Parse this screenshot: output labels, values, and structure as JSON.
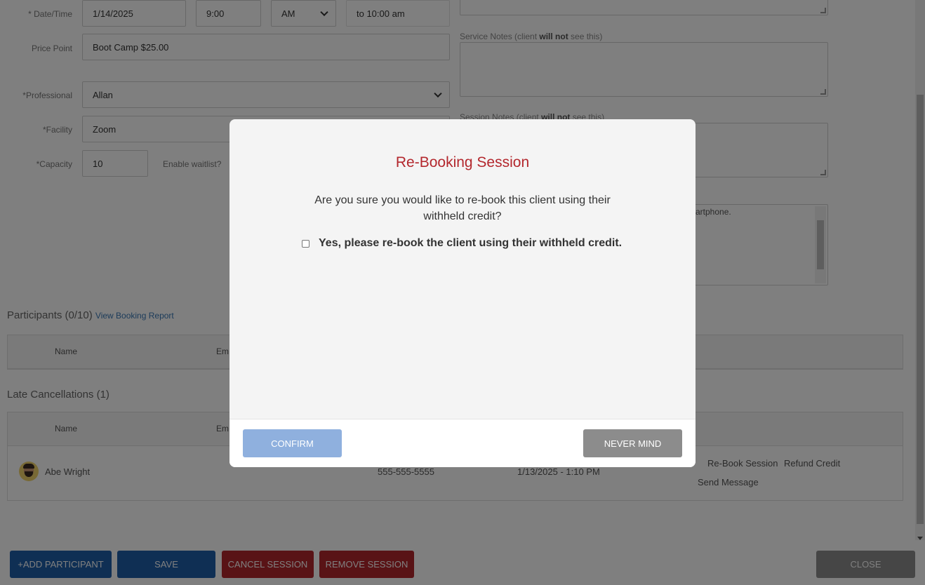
{
  "form": {
    "datetime_label": "* Date/Time",
    "date_value": "1/14/2025",
    "time_value": "9:00",
    "ampm_value": "AM",
    "end_time": "to 10:00 am",
    "price_label": "Price Point",
    "price_value": "Boot Camp $25.00",
    "professional_label": "*Professional",
    "professional_value": "Allan",
    "facility_label": "*Facility",
    "facility_value": "Zoom",
    "capacity_label": "*Capacity",
    "capacity_value": "10",
    "waitlist_label": "Enable waitlist?"
  },
  "notes": {
    "service_notes_prefix": "Service Notes (client ",
    "service_notes_bold": "will not",
    "service_notes_suffix": " see this)",
    "session_notes_prefix": "Session Notes (client ",
    "session_notes_bold": "will not",
    "session_notes_suffix": " see this)",
    "third_note_fragment": "artphone."
  },
  "participants": {
    "title": "Participants (0/10)",
    "report_link": "View Booking Report",
    "col_name": "Name",
    "col_email": "Em"
  },
  "late_cancellations": {
    "title": "Late Cancellations (1)",
    "col_name": "Name",
    "col_email": "Em",
    "rows": [
      {
        "name": "Abe Wright",
        "phone": "555-555-5555",
        "cancelled_at": "1/13/2025 - 1:10 PM",
        "rebook": "Re-Book Session",
        "refund": "Refund Credit",
        "message": "Send Message"
      }
    ]
  },
  "bottom_buttons": {
    "add_participant": "+ADD PARTICIPANT",
    "save": "SAVE",
    "cancel_session": "CANCEL SESSION",
    "remove_session": "REMOVE SESSION",
    "close": "CLOSE"
  },
  "modal": {
    "title": "Re-Booking Session",
    "message": "Are you sure you would like to re-book this client using their withheld credit?",
    "checkbox_label": "Yes, please re-book the client using their withheld credit.",
    "confirm": "CONFIRM",
    "never_mind": "NEVER MIND"
  },
  "colors": {
    "primary_blue": "#1f5fa8",
    "danger_red": "#b3272d",
    "title_red": "#b3272d",
    "confirm_disabled": "#8fb0de",
    "never_mind_gray": "#8c8c8c"
  }
}
